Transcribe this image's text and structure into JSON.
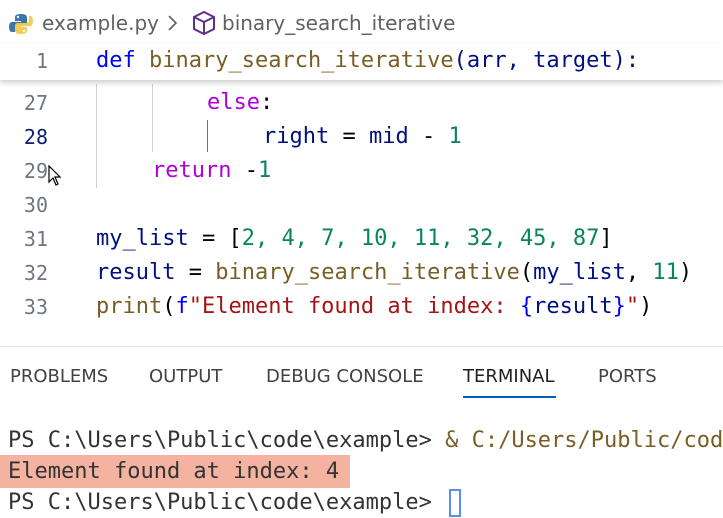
{
  "breadcrumb": {
    "file": "example.py",
    "symbol": "binary_search_iterative"
  },
  "sticky_line": {
    "number": "1",
    "def_kw": "def",
    "fn_name": "binary_search_iterative",
    "params": "(arr, target):"
  },
  "lines": {
    "l27": {
      "number": "27",
      "kw": "else",
      "rest": ":"
    },
    "l28": {
      "number": "28",
      "var": "right",
      "eq": " = ",
      "mid": "mid",
      "minus": " - ",
      "num": "1"
    },
    "l29": {
      "number": "29",
      "kw": "return",
      "rest": " -",
      "num": "1"
    },
    "l30": {
      "number": "30"
    },
    "l31": {
      "number": "31",
      "var": "my_list",
      "eq": " = [",
      "nums": "2, 4, 7, 10, 11, 32, 45, 87",
      "close": "]"
    },
    "l32": {
      "number": "32",
      "var": "result",
      "eq": " = ",
      "fn": "binary_search_iterative",
      "args_open": "(",
      "arg": "my_list",
      "comma": ", ",
      "num": "11",
      "close": ")"
    },
    "l33": {
      "number": "33",
      "fn": "print",
      "open": "(",
      "fprefix": "f",
      "str": "\"Element found at index: ",
      "brace_open": "{",
      "var": "result",
      "brace_close": "}",
      "str_end": "\"",
      "close": ")"
    }
  },
  "panel_tabs": {
    "problems": "PROBLEMS",
    "output": "OUTPUT",
    "debug_console": "DEBUG CONSOLE",
    "terminal": "TERMINAL",
    "ports": "PORTS"
  },
  "terminal": {
    "prompt1": "PS C:\\Users\\Public\\code\\example> ",
    "cmd1": "& C:/Users/Public/code",
    "output": "Element found at index: 4",
    "prompt2": "PS C:\\Users\\Public\\code\\example> "
  },
  "colors": {
    "highlight": "#f4b3a1",
    "active_tab_underline": "#005fb8"
  }
}
